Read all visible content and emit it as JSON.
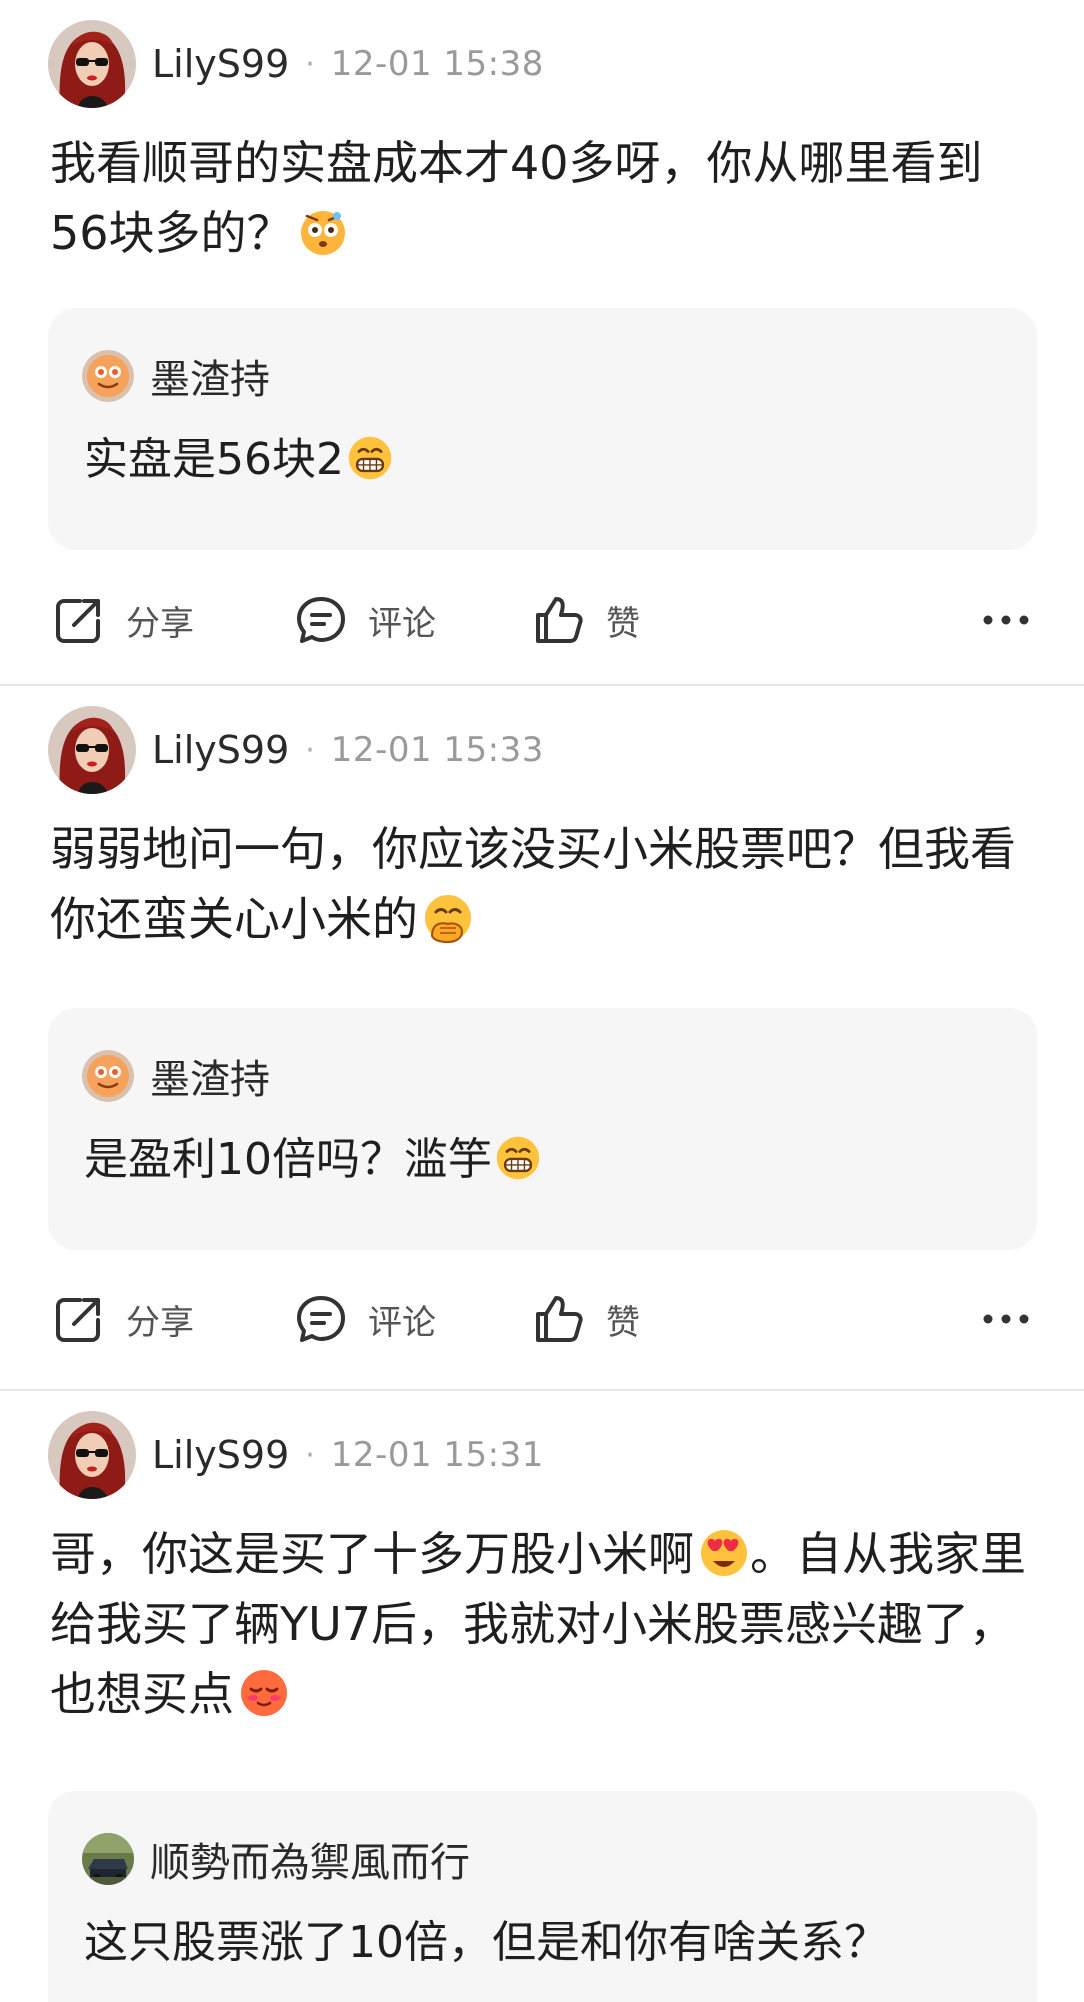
{
  "comments": [
    {
      "username": "LilyS99",
      "separator": "·",
      "time": "12-01 15:38",
      "text": "我看顺哥的实盘成本才40多呀，你从哪里看到56块多的？",
      "emoji": "dizzy-thinking-emoji",
      "reply": {
        "username": "墨渣持",
        "text": "实盘是56块2",
        "emoji": "grinning-emoji"
      },
      "actions": {
        "share": "分享",
        "comment": "评论",
        "like": "赞"
      }
    },
    {
      "username": "LilyS99",
      "separator": "·",
      "time": "12-01 15:33",
      "text": "弱弱地问一句，你应该没买小米股票吧？但我看你还蛮关心小米的",
      "emoji": "hand-over-mouth-emoji",
      "reply": {
        "username": "墨渣持",
        "text": "是盈利10倍吗？滥竽",
        "emoji": "grinning-emoji"
      },
      "actions": {
        "share": "分享",
        "comment": "评论",
        "like": "赞"
      }
    },
    {
      "username": "LilyS99",
      "separator": "·",
      "time": "12-01 15:31",
      "text_part1": "哥，你这是买了十多万股小米啊",
      "text_part2": "。自从我家里给我买了辆YU7后，我就对小米股票感兴趣了，也想买点",
      "emoji1": "heart-eyes-emoji",
      "emoji2": "blushing-emoji",
      "reply": {
        "username": "顺勢而為禦風而行",
        "text": "这只股票涨了10倍，但是和你有啥关系？"
      }
    }
  ],
  "colors": {
    "background": "#ffffff",
    "reply_background": "#f6f6f7",
    "timestamp": "#9a9a9a",
    "divider": "#e6e6e6"
  }
}
